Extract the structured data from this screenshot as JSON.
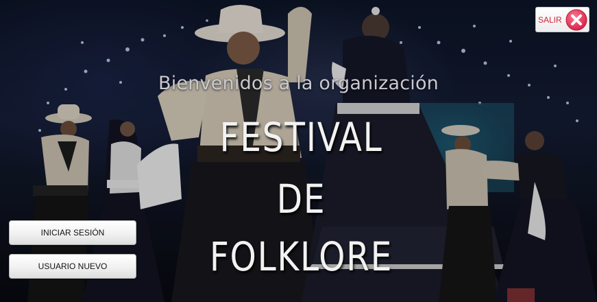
{
  "app": {
    "welcome_text": "Bienvenidos a la organización",
    "title_lines": [
      "FESTIVAL",
      "DE",
      "FOLKLORE"
    ]
  },
  "buttons": {
    "login_label": "INICIAR SESIÓN",
    "new_user_label": "USUARIO NUEVO",
    "exit_label": "SALIR"
  },
  "icons": {
    "exit_icon": "close-x-circle-icon"
  },
  "colors": {
    "exit_text": "#d2243a",
    "exit_icon_fill": "#e8385a",
    "title_text": "#f2f2f2",
    "welcome_text": "#c9c9cf"
  }
}
